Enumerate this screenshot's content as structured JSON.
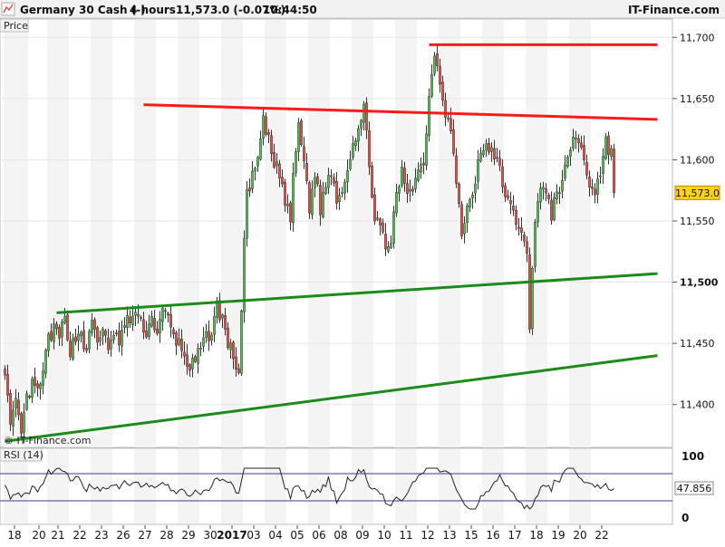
{
  "header": {
    "instrument": "Germany 30 Cash (-)",
    "timeframe": "4 hours",
    "last_price": "11,573.0 (-0.07%)",
    "time": "10:44:50",
    "brand": "IT-Finance.com"
  },
  "price_panel": {
    "label": "Price",
    "watermark": "© IT-Finance.com",
    "current_price_label": "11,573.0"
  },
  "rsi_panel": {
    "label": "RSI (14)",
    "current_value_label": "47.856"
  },
  "colors": {
    "up_candle": "#5cb85c",
    "down_candle": "#d9534f",
    "resistance": "#ff1a1a",
    "support": "#1a8c1a",
    "rsi_line": "#222222",
    "rsi_bounds": "#3a3a9a",
    "price_label_bg": "#ffd21a"
  },
  "chart_data": {
    "type": "candlestick",
    "y_axis": {
      "min": 11365,
      "max": 11715,
      "ticks": [
        "11,400",
        "11,450",
        "11,500",
        "11,550",
        "11,600",
        "11,650",
        "11,700"
      ]
    },
    "x_axis": {
      "labels": [
        "18",
        "20",
        "21",
        "22",
        "23",
        "26",
        "27",
        "28",
        "29",
        "30",
        "2017",
        "03",
        "04",
        "05",
        "06",
        "08",
        "09",
        "10",
        "11",
        "12",
        "13",
        "15",
        "16",
        "17",
        "18",
        "19",
        "20",
        "22"
      ],
      "label_bar_index": [
        3,
        12,
        19,
        27,
        35,
        43,
        51,
        59,
        67,
        75,
        83,
        91,
        99,
        107,
        115,
        123,
        131,
        139,
        147,
        155,
        163,
        171,
        179,
        187,
        195,
        203,
        211,
        219
      ]
    },
    "bar_count": 225,
    "anchors": [
      [
        0,
        11430
      ],
      [
        2,
        11380
      ],
      [
        4,
        11400
      ],
      [
        6,
        11375
      ],
      [
        8,
        11405
      ],
      [
        10,
        11415
      ],
      [
        12,
        11410
      ],
      [
        14,
        11425
      ],
      [
        16,
        11455
      ],
      [
        18,
        11460
      ],
      [
        20,
        11455
      ],
      [
        22,
        11470
      ],
      [
        24,
        11445
      ],
      [
        26,
        11455
      ],
      [
        28,
        11460
      ],
      [
        30,
        11440
      ],
      [
        32,
        11470
      ],
      [
        34,
        11450
      ],
      [
        36,
        11465
      ],
      [
        38,
        11440
      ],
      [
        40,
        11460
      ],
      [
        42,
        11450
      ],
      [
        44,
        11465
      ],
      [
        46,
        11470
      ],
      [
        48,
        11475
      ],
      [
        50,
        11465
      ],
      [
        52,
        11460
      ],
      [
        54,
        11470
      ],
      [
        56,
        11460
      ],
      [
        58,
        11475
      ],
      [
        60,
        11470
      ],
      [
        62,
        11455
      ],
      [
        64,
        11450
      ],
      [
        66,
        11440
      ],
      [
        68,
        11430
      ],
      [
        70,
        11435
      ],
      [
        72,
        11445
      ],
      [
        74,
        11455
      ],
      [
        76,
        11460
      ],
      [
        78,
        11480
      ],
      [
        80,
        11470
      ],
      [
        82,
        11450
      ],
      [
        84,
        11440
      ],
      [
        86,
        11425
      ],
      [
        88,
        11530
      ],
      [
        89,
        11575
      ],
      [
        91,
        11585
      ],
      [
        93,
        11600
      ],
      [
        95,
        11630
      ],
      [
        97,
        11615
      ],
      [
        99,
        11595
      ],
      [
        101,
        11590
      ],
      [
        103,
        11565
      ],
      [
        105,
        11550
      ],
      [
        106,
        11590
      ],
      [
        108,
        11625
      ],
      [
        110,
        11600
      ],
      [
        112,
        11560
      ],
      [
        114,
        11590
      ],
      [
        116,
        11560
      ],
      [
        118,
        11580
      ],
      [
        120,
        11590
      ],
      [
        122,
        11570
      ],
      [
        124,
        11575
      ],
      [
        126,
        11595
      ],
      [
        128,
        11615
      ],
      [
        130,
        11625
      ],
      [
        132,
        11640
      ],
      [
        134,
        11600
      ],
      [
        136,
        11550
      ],
      [
        138,
        11545
      ],
      [
        140,
        11525
      ],
      [
        142,
        11535
      ],
      [
        144,
        11570
      ],
      [
        146,
        11590
      ],
      [
        148,
        11575
      ],
      [
        150,
        11580
      ],
      [
        152,
        11590
      ],
      [
        154,
        11600
      ],
      [
        156,
        11650
      ],
      [
        158,
        11690
      ],
      [
        160,
        11665
      ],
      [
        162,
        11640
      ],
      [
        164,
        11625
      ],
      [
        166,
        11580
      ],
      [
        168,
        11540
      ],
      [
        170,
        11560
      ],
      [
        172,
        11575
      ],
      [
        174,
        11595
      ],
      [
        176,
        11610
      ],
      [
        178,
        11610
      ],
      [
        180,
        11600
      ],
      [
        182,
        11595
      ],
      [
        184,
        11570
      ],
      [
        186,
        11560
      ],
      [
        188,
        11550
      ],
      [
        190,
        11545
      ],
      [
        192,
        11520
      ],
      [
        193,
        11460
      ],
      [
        195,
        11555
      ],
      [
        197,
        11580
      ],
      [
        199,
        11570
      ],
      [
        201,
        11555
      ],
      [
        203,
        11575
      ],
      [
        205,
        11580
      ],
      [
        207,
        11600
      ],
      [
        209,
        11620
      ],
      [
        211,
        11615
      ],
      [
        213,
        11600
      ],
      [
        215,
        11580
      ],
      [
        217,
        11575
      ],
      [
        219,
        11590
      ],
      [
        221,
        11615
      ],
      [
        223,
        11605
      ],
      [
        225,
        11595
      ],
      [
        227,
        11600
      ],
      [
        229,
        11590
      ],
      [
        231,
        11605
      ],
      [
        233,
        11610
      ],
      [
        235,
        11600
      ],
      [
        237,
        11580
      ],
      [
        239,
        11565
      ],
      [
        240,
        11573
      ]
    ],
    "resistance_lines": [
      {
        "from": [
          51,
          11645
        ],
        "to": [
          240,
          11633
        ]
      },
      {
        "from": [
          156,
          11694
        ],
        "to": [
          240,
          11694
        ]
      }
    ],
    "support_lines": [
      {
        "from": [
          19,
          11475
        ],
        "to": [
          240,
          11507
        ]
      },
      {
        "from": [
          0,
          11370
        ],
        "to": [
          240,
          11440
        ]
      }
    ],
    "current_price": 11573.0,
    "rsi": {
      "period": 14,
      "y_axis": {
        "min": 0,
        "max": 100,
        "ticks": [
          "100",
          "0"
        ]
      },
      "upper_bound": 70,
      "lower_bound": 30,
      "current": 47.856
    }
  }
}
